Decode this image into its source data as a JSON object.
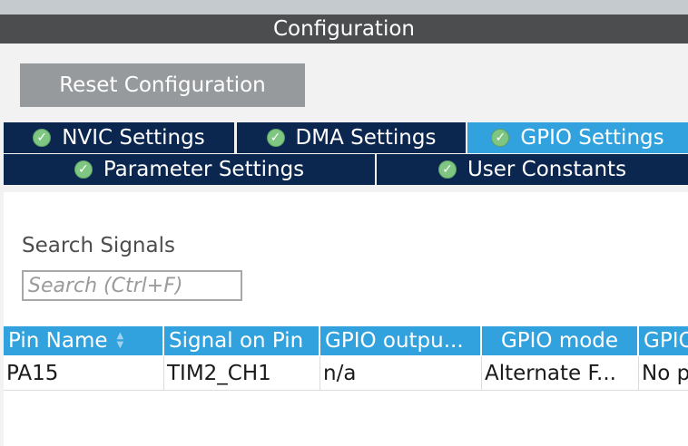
{
  "window": {
    "title": "Configuration"
  },
  "actions": {
    "reset_label": "Reset Configuration"
  },
  "tabs": [
    {
      "label": "NVIC Settings",
      "icon": "check-circle-icon",
      "active": false
    },
    {
      "label": "DMA Settings",
      "icon": "check-circle-icon",
      "active": false
    },
    {
      "label": "GPIO Settings",
      "icon": "check-circle-icon",
      "active": true
    },
    {
      "label": "Parameter Settings",
      "icon": "check-circle-icon",
      "active": false
    },
    {
      "label": "User Constants",
      "icon": "check-circle-icon",
      "active": false
    }
  ],
  "search": {
    "label": "Search Signals",
    "placeholder": "Search (Ctrl+F)",
    "value": ""
  },
  "table": {
    "columns": [
      "Pin Name",
      "Signal on Pin",
      "GPIO outpu...",
      "GPIO mode",
      "GPIO"
    ],
    "rows": [
      [
        "PA15",
        "TIM2_CH1",
        "n/a",
        "Alternate F...",
        "No p"
      ]
    ]
  },
  "colors": {
    "tab_bg": "#0b2750",
    "tab_active_bg": "#31a2dd",
    "header_bg": "#31a2dd",
    "titlebar_bg": "#4b4d4f",
    "check_green": "#7fc683"
  }
}
